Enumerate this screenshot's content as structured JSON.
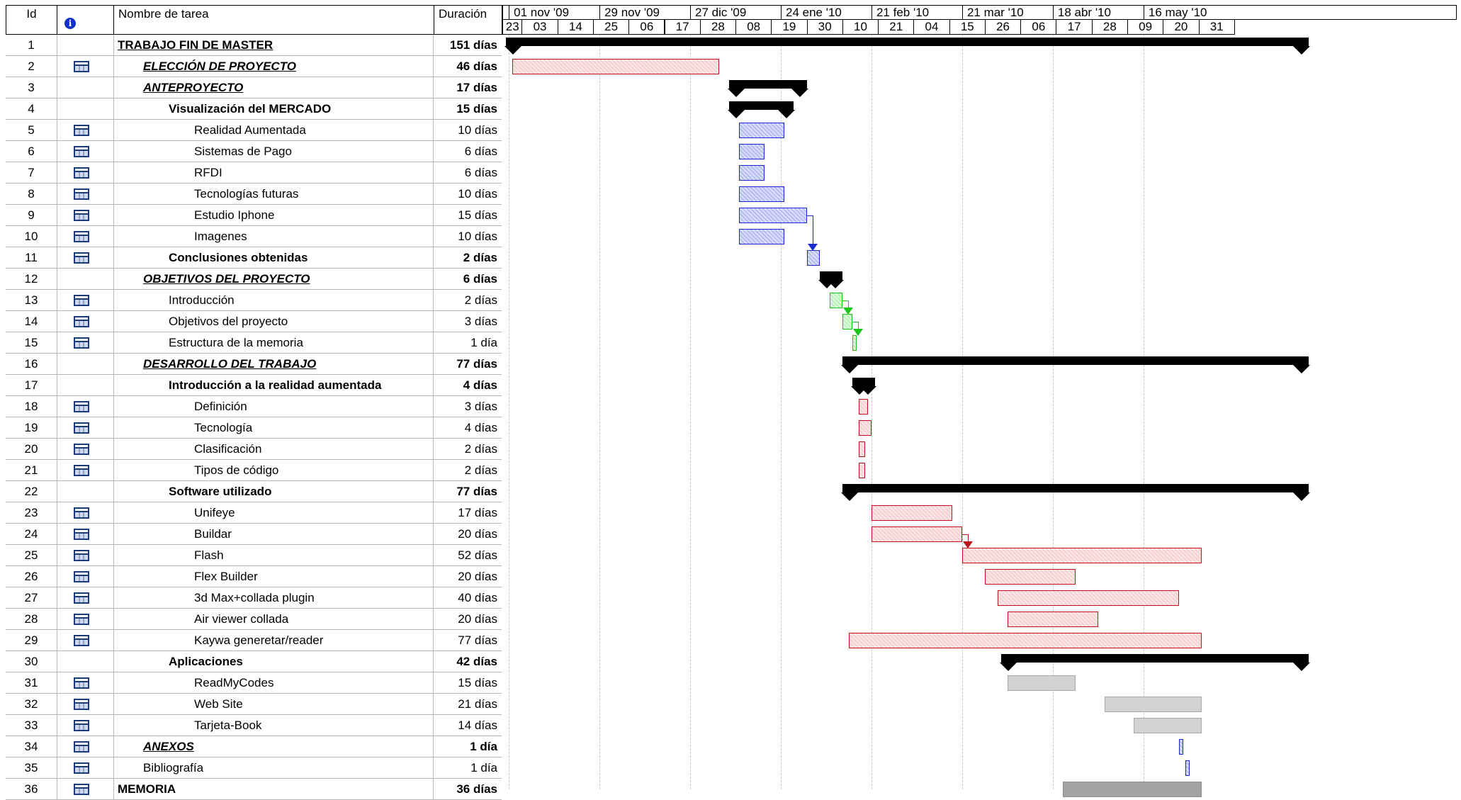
{
  "columns": {
    "id": "Id",
    "info": "info-icon",
    "name": "Nombre de tarea",
    "duration": "Duración"
  },
  "timescale": {
    "months": [
      "01 nov '09",
      "29 nov '09",
      "27 dic '09",
      "24 ene '10",
      "21 feb '10",
      "21 mar '10",
      "18 abr '10",
      "16 may '10"
    ],
    "days": [
      "23",
      "03",
      "14",
      "25",
      "06",
      "17",
      "28",
      "08",
      "19",
      "30",
      "10",
      "21",
      "04",
      "15",
      "26",
      "06",
      "17",
      "28",
      "09",
      "20",
      "31"
    ]
  },
  "colors": {
    "red": "#c0141c",
    "blue": "#1a2ad0",
    "green": "#18c818",
    "gray": "#d2d2d2",
    "dark_gray": "#a2a2a2",
    "summary": "#000000",
    "task_icon": "#1b3a7a"
  },
  "tasks": [
    {
      "id": "1",
      "name": "TRABAJO FIN DE MASTER",
      "duration": "151 días",
      "indent": 0,
      "style": "bold-underline",
      "icon": false,
      "bar": {
        "kind": "summary",
        "start": "2009-10-24",
        "end": "2010-06-29"
      }
    },
    {
      "id": "2",
      "name": "ELECCIÓN DE PROYECTO",
      "duration": "46 días",
      "indent": 1,
      "style": "bold-italic-underline",
      "icon": true,
      "bar": {
        "kind": "task",
        "color": "red",
        "start": "2009-10-26",
        "end": "2009-12-29"
      }
    },
    {
      "id": "3",
      "name": "ANTEPROYECTO",
      "duration": "17 días",
      "indent": 1,
      "style": "bold-italic-underline",
      "icon": false,
      "bar": {
        "kind": "summary",
        "start": "2010-01-01",
        "end": "2010-01-25"
      }
    },
    {
      "id": "4",
      "name": "Visualización del MERCADO",
      "duration": "15 días",
      "indent": 2,
      "style": "bold",
      "icon": false,
      "bar": {
        "kind": "summary",
        "start": "2010-01-01",
        "end": "2010-01-21"
      }
    },
    {
      "id": "5",
      "name": "Realidad Aumentada",
      "duration": "10 días",
      "indent": 3,
      "style": "normal",
      "icon": true,
      "bar": {
        "kind": "task",
        "color": "blue",
        "start": "2010-01-04",
        "end": "2010-01-18"
      }
    },
    {
      "id": "6",
      "name": "Sistemas de Pago",
      "duration": "6 días",
      "indent": 3,
      "style": "normal",
      "icon": true,
      "bar": {
        "kind": "task",
        "color": "blue",
        "start": "2010-01-04",
        "end": "2010-01-12"
      }
    },
    {
      "id": "7",
      "name": "RFDI",
      "duration": "6 días",
      "indent": 3,
      "style": "normal",
      "icon": true,
      "bar": {
        "kind": "task",
        "color": "blue",
        "start": "2010-01-04",
        "end": "2010-01-12"
      }
    },
    {
      "id": "8",
      "name": "Tecnologías futuras",
      "duration": "10 días",
      "indent": 3,
      "style": "normal",
      "icon": true,
      "bar": {
        "kind": "task",
        "color": "blue",
        "start": "2010-01-04",
        "end": "2010-01-18"
      }
    },
    {
      "id": "9",
      "name": "Estudio Iphone",
      "duration": "15 días",
      "indent": 3,
      "style": "normal",
      "icon": true,
      "bar": {
        "kind": "task",
        "color": "blue",
        "start": "2010-01-04",
        "end": "2010-01-25"
      }
    },
    {
      "id": "10",
      "name": "Imagenes",
      "duration": "10 días",
      "indent": 3,
      "style": "normal",
      "icon": true,
      "bar": {
        "kind": "task",
        "color": "blue",
        "start": "2010-01-04",
        "end": "2010-01-18"
      }
    },
    {
      "id": "11",
      "name": "Conclusiones obtenidas",
      "duration": "2 días",
      "indent": 2,
      "style": "bold",
      "icon": true,
      "bar": {
        "kind": "task",
        "color": "blue",
        "start": "2010-01-25",
        "end": "2010-01-29"
      }
    },
    {
      "id": "12",
      "name": "OBJETIVOS DEL PROYECTO",
      "duration": "6 días",
      "indent": 1,
      "style": "bold-italic-underline",
      "icon": false,
      "bar": {
        "kind": "summary",
        "start": "2010-01-29",
        "end": "2010-02-05"
      }
    },
    {
      "id": "13",
      "name": "Introducción",
      "duration": "2 días",
      "indent": 2,
      "style": "normal",
      "icon": true,
      "bar": {
        "kind": "task",
        "color": "green",
        "start": "2010-02-01",
        "end": "2010-02-05"
      }
    },
    {
      "id": "14",
      "name": "Objetivos del proyecto",
      "duration": "3 días",
      "indent": 2,
      "style": "normal",
      "icon": true,
      "bar": {
        "kind": "task",
        "color": "green",
        "start": "2010-02-05",
        "end": "2010-02-08"
      }
    },
    {
      "id": "15",
      "name": "Estructura de la memoria",
      "duration": "1 día",
      "indent": 2,
      "style": "normal",
      "icon": true,
      "bar": {
        "kind": "task",
        "color": "green",
        "start": "2010-02-08",
        "end": "2010-02-09"
      }
    },
    {
      "id": "16",
      "name": "DESARROLLO DEL TRABAJO",
      "duration": "77 días",
      "indent": 1,
      "style": "bold-italic-underline",
      "icon": false,
      "bar": {
        "kind": "summary",
        "start": "2010-02-05",
        "end": "2010-06-29"
      }
    },
    {
      "id": "17",
      "name": "Introducción a la realidad aumentada",
      "duration": "4 días",
      "indent": 2,
      "style": "bold",
      "icon": false,
      "bar": {
        "kind": "summary",
        "start": "2010-02-08",
        "end": "2010-02-15"
      }
    },
    {
      "id": "18",
      "name": "Definición",
      "duration": "3 días",
      "indent": 3,
      "style": "normal",
      "icon": true,
      "bar": {
        "kind": "task",
        "color": "red",
        "start": "2010-02-10",
        "end": "2010-02-13"
      }
    },
    {
      "id": "19",
      "name": "Tecnología",
      "duration": "4 días",
      "indent": 3,
      "style": "normal",
      "icon": true,
      "bar": {
        "kind": "task",
        "color": "red",
        "start": "2010-02-10",
        "end": "2010-02-14"
      }
    },
    {
      "id": "20",
      "name": "Clasificación",
      "duration": "2 días",
      "indent": 3,
      "style": "normal",
      "icon": true,
      "bar": {
        "kind": "task",
        "color": "red",
        "start": "2010-02-10",
        "end": "2010-02-12"
      }
    },
    {
      "id": "21",
      "name": "Tipos de código",
      "duration": "2 días",
      "indent": 3,
      "style": "normal",
      "icon": true,
      "bar": {
        "kind": "task",
        "color": "red",
        "start": "2010-02-10",
        "end": "2010-02-12"
      }
    },
    {
      "id": "22",
      "name": "Software utilizado",
      "duration": "77 días",
      "indent": 2,
      "style": "bold",
      "icon": false,
      "bar": {
        "kind": "summary",
        "start": "2010-02-05",
        "end": "2010-06-29"
      }
    },
    {
      "id": "23",
      "name": "Unifeye",
      "duration": "17 días",
      "indent": 3,
      "style": "normal",
      "icon": true,
      "bar": {
        "kind": "task",
        "color": "red",
        "start": "2010-02-14",
        "end": "2010-03-11"
      }
    },
    {
      "id": "24",
      "name": "Buildar",
      "duration": "20 días",
      "indent": 3,
      "style": "normal",
      "icon": true,
      "bar": {
        "kind": "task",
        "color": "red",
        "start": "2010-02-14",
        "end": "2010-03-14"
      }
    },
    {
      "id": "25",
      "name": "Flash",
      "duration": "52 días",
      "indent": 3,
      "style": "normal",
      "icon": true,
      "bar": {
        "kind": "task",
        "color": "red",
        "start": "2010-03-14",
        "end": "2010-05-27"
      }
    },
    {
      "id": "26",
      "name": "Flex Builder",
      "duration": "20 días",
      "indent": 3,
      "style": "normal",
      "icon": true,
      "bar": {
        "kind": "task",
        "color": "red",
        "start": "2010-03-21",
        "end": "2010-04-18"
      }
    },
    {
      "id": "27",
      "name": "3d Max+collada plugin",
      "duration": "40 días",
      "indent": 3,
      "style": "normal",
      "icon": true,
      "bar": {
        "kind": "task",
        "color": "red",
        "start": "2010-03-25",
        "end": "2010-05-20"
      }
    },
    {
      "id": "28",
      "name": "Air viewer collada",
      "duration": "20 días",
      "indent": 3,
      "style": "normal",
      "icon": true,
      "bar": {
        "kind": "task",
        "color": "red",
        "start": "2010-03-28",
        "end": "2010-04-25"
      }
    },
    {
      "id": "29",
      "name": "Kaywa generetar/reader",
      "duration": "77 días",
      "indent": 3,
      "style": "normal",
      "icon": true,
      "bar": {
        "kind": "task",
        "color": "red",
        "start": "2010-02-07",
        "end": "2010-05-27"
      }
    },
    {
      "id": "30",
      "name": "Aplicaciones",
      "duration": "42 días",
      "indent": 2,
      "style": "bold",
      "icon": false,
      "bar": {
        "kind": "summary",
        "start": "2010-03-26",
        "end": "2010-06-29"
      }
    },
    {
      "id": "31",
      "name": "ReadMyCodes",
      "duration": "15 días",
      "indent": 3,
      "style": "normal",
      "icon": true,
      "bar": {
        "kind": "task",
        "color": "gray",
        "start": "2010-03-28",
        "end": "2010-04-18"
      }
    },
    {
      "id": "32",
      "name": "Web Site",
      "duration": "21 días",
      "indent": 3,
      "style": "normal",
      "icon": true,
      "bar": {
        "kind": "task",
        "color": "gray",
        "start": "2010-04-27",
        "end": "2010-05-27"
      }
    },
    {
      "id": "33",
      "name": "Tarjeta-Book",
      "duration": "14 días",
      "indent": 3,
      "style": "normal",
      "icon": true,
      "bar": {
        "kind": "task",
        "color": "gray",
        "start": "2010-05-06",
        "end": "2010-05-27"
      }
    },
    {
      "id": "34",
      "name": "ANEXOS",
      "duration": "1 día",
      "indent": 1,
      "style": "bold-italic-underline",
      "icon": true,
      "bar": {
        "kind": "task",
        "color": "blue",
        "start": "2010-05-20",
        "end": "2010-05-21"
      }
    },
    {
      "id": "35",
      "name": "Bibliografía",
      "duration": "1 día",
      "indent": 1,
      "style": "normal",
      "icon": true,
      "bar": {
        "kind": "task",
        "color": "blue",
        "start": "2010-05-22",
        "end": "2010-05-23"
      }
    },
    {
      "id": "36",
      "name": "MEMORIA",
      "duration": "36 días",
      "indent": 0,
      "style": "bold",
      "icon": true,
      "bar": {
        "kind": "task",
        "color": "dark_gray",
        "start": "2010-04-14",
        "end": "2010-05-27"
      }
    }
  ],
  "dependencies": [
    {
      "from": "9",
      "to": "11",
      "color": "blue"
    },
    {
      "from": "13",
      "to": "14",
      "color": "green"
    },
    {
      "from": "14",
      "to": "15",
      "color": "green"
    },
    {
      "from": "24",
      "to": "25",
      "color": "red"
    }
  ]
}
